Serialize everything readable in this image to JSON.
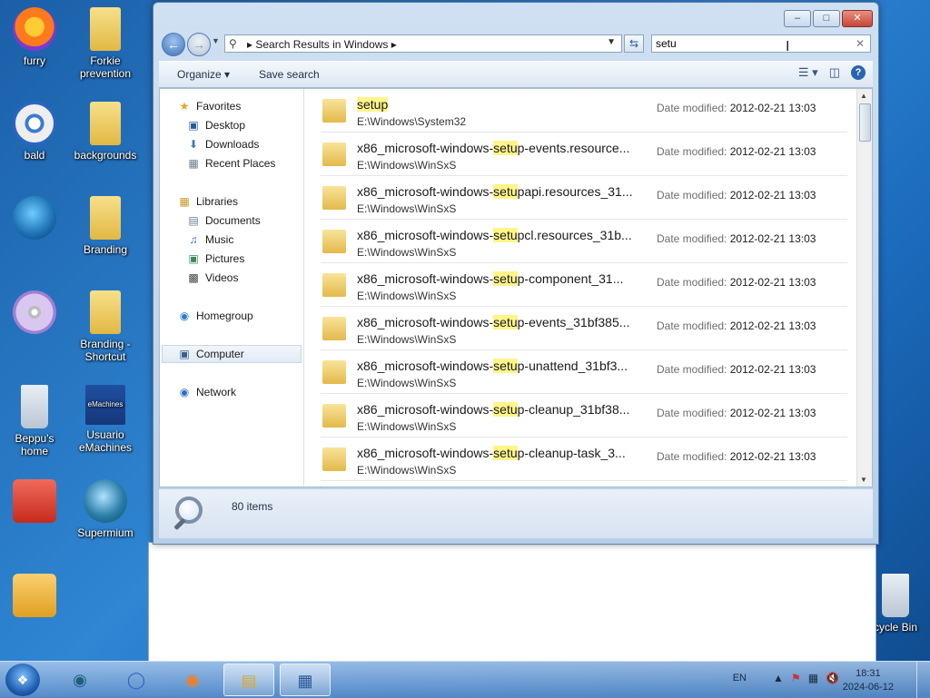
{
  "desktop": {
    "icons": [
      {
        "label": "furry"
      },
      {
        "label": "Forkie prevention"
      },
      {
        "label": "bald"
      },
      {
        "label": "backgrounds"
      },
      {
        "label": ""
      },
      {
        "label": "Branding"
      },
      {
        "label": ""
      },
      {
        "label": "Branding - Shortcut"
      },
      {
        "label": "Beppu's home"
      },
      {
        "label": "Usuario eMachines"
      },
      {
        "label": ""
      },
      {
        "label": "Supermium"
      },
      {
        "label": ""
      },
      {
        "label": "cycle Bin"
      }
    ],
    "emachines_text": "eMachines"
  },
  "window": {
    "controls": {
      "minimize": "–",
      "maximize": "□",
      "close": "✕"
    },
    "address": {
      "breadcrumb": "Search Results in Windows",
      "sep1": "▸",
      "sep2": "▸"
    },
    "search": {
      "value": "setu"
    },
    "toolbar": {
      "organize": "Organize ▾",
      "save_search": "Save search"
    },
    "nav": {
      "favorites": "Favorites",
      "desktop": "Desktop",
      "downloads": "Downloads",
      "recent": "Recent Places",
      "libraries": "Libraries",
      "documents": "Documents",
      "music": "Music",
      "pictures": "Pictures",
      "videos": "Videos",
      "homegroup": "Homegroup",
      "computer": "Computer",
      "network": "Network"
    },
    "date_label": "Date modified:",
    "results": [
      {
        "pre": "",
        "hl": "setup",
        "post": "",
        "path": "E:\\Windows\\System32",
        "date": "2012-02-21 13:03"
      },
      {
        "pre": "x86_microsoft-windows-",
        "hl": "setu",
        "post": "p-events.resource...",
        "path": "E:\\Windows\\WinSxS",
        "date": "2012-02-21 13:03"
      },
      {
        "pre": "x86_microsoft-windows-",
        "hl": "setu",
        "post": "papi.resources_31...",
        "path": "E:\\Windows\\WinSxS",
        "date": "2012-02-21 13:03"
      },
      {
        "pre": "x86_microsoft-windows-",
        "hl": "setu",
        "post": "pcl.resources_31b...",
        "path": "E:\\Windows\\WinSxS",
        "date": "2012-02-21 13:03"
      },
      {
        "pre": "x86_microsoft-windows-",
        "hl": "setu",
        "post": "p-component_31...",
        "path": "E:\\Windows\\WinSxS",
        "date": "2012-02-21 13:03"
      },
      {
        "pre": "x86_microsoft-windows-",
        "hl": "setu",
        "post": "p-events_31bf385...",
        "path": "E:\\Windows\\WinSxS",
        "date": "2012-02-21 13:03"
      },
      {
        "pre": "x86_microsoft-windows-",
        "hl": "setu",
        "post": "p-unattend_31bf3...",
        "path": "E:\\Windows\\WinSxS",
        "date": "2012-02-21 13:03"
      },
      {
        "pre": "x86_microsoft-windows-",
        "hl": "setu",
        "post": "p-cleanup_31bf38...",
        "path": "E:\\Windows\\WinSxS",
        "date": "2012-02-21 13:03"
      },
      {
        "pre": "x86_microsoft-windows-",
        "hl": "setu",
        "post": "p-cleanup-task_3...",
        "path": "E:\\Windows\\WinSxS",
        "date": "2012-02-21 13:03"
      }
    ],
    "details": {
      "count": "80 items"
    }
  },
  "taskbar": {
    "lang": "EN",
    "time": "18:31",
    "date": "2024-06-12"
  }
}
